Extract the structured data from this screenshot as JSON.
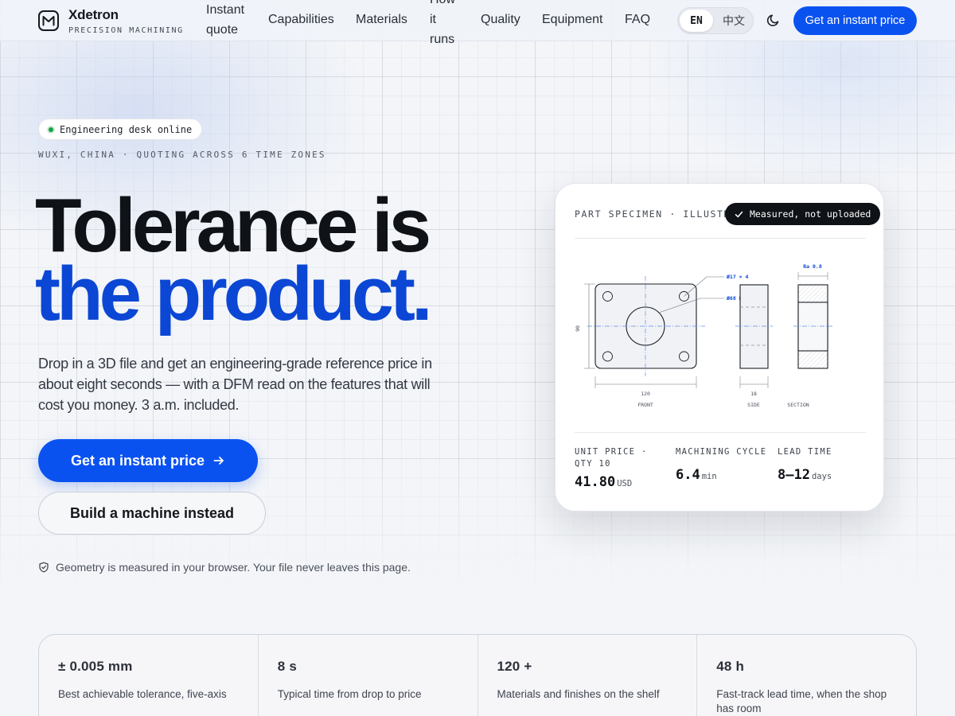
{
  "brand": {
    "name": "Xdetron",
    "sub": "PRECISION MACHINING"
  },
  "nav": {
    "links": [
      "Instant quote",
      "Capabilities",
      "Materials",
      "How it runs",
      "Quality",
      "Equipment",
      "FAQ"
    ],
    "lang_en": "EN",
    "lang_zh": "中文",
    "cta": "Get an instant price"
  },
  "hero": {
    "status": "Engineering desk online",
    "location": "WUXI, CHINA · QUOTING ACROSS 6 TIME ZONES",
    "headline_1": "Tolerance is",
    "headline_2": "the product.",
    "lede": "Drop in a 3D file and get an engineering-grade reference price in about eight seconds — with a DFM read on the features that will cost you money. 3 a.m. included.",
    "cta_primary": "Get an instant price",
    "cta_secondary": "Build a machine instead",
    "privacy": "Geometry is measured in your browser. Your file never leaves this page."
  },
  "card": {
    "kicker": "PART SPECIMEN · ILLUSTRATIVE",
    "badge": "Measured, not uploaded",
    "drawing": {
      "callout_holes": "Ø17 × 4",
      "callout_bore": "Ø68 H7",
      "callout_ra": "Ra 0.8",
      "dim_height": "90",
      "dim_width": "120",
      "dim_depth": "18",
      "view_front": "FRONT",
      "view_side": "SIDE",
      "view_section": "SECTION"
    },
    "metrics": [
      {
        "label": "UNIT PRICE · QTY 10",
        "value": "41.80",
        "unit": "USD"
      },
      {
        "label": "MACHINING CYCLE",
        "value": "6.4",
        "unit": "min"
      },
      {
        "label": "LEAD TIME",
        "value": "8–12",
        "unit": "days"
      }
    ]
  },
  "stats": [
    {
      "value": "± 0.005 mm",
      "desc": "Best achievable tolerance, five-axis"
    },
    {
      "value": "8 s",
      "desc": "Typical time from drop to price"
    },
    {
      "value": "120 +",
      "desc": "Materials and finishes on the shelf"
    },
    {
      "value": "48 h",
      "desc": "Fast-track lead time, when the shop has room"
    }
  ],
  "colors": {
    "accent": "#0a52f0",
    "headline_blue": "#0b47d4",
    "ink": "#0f1217"
  }
}
